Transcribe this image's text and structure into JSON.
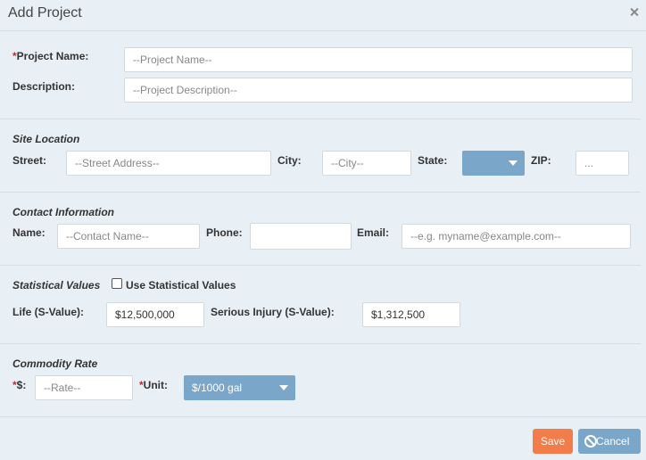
{
  "dialog": {
    "title": "Add Project"
  },
  "project": {
    "name_label_req": "*",
    "name_label": "Project Name:",
    "name_placeholder": "--Project Name--",
    "description_label": "Description:",
    "description_placeholder": "--Project Description--"
  },
  "site_location": {
    "heading": "Site Location",
    "street_label": "Street:",
    "street_placeholder": "--Street Address--",
    "city_label": "City:",
    "city_placeholder": "--City--",
    "state_label": "State:",
    "state_value": "",
    "zip_label": "ZIP:",
    "zip_placeholder": "..."
  },
  "contact": {
    "heading": "Contact Information",
    "name_label": "Name:",
    "name_placeholder": "--Contact Name--",
    "phone_label": "Phone:",
    "phone_value": "",
    "email_label": "Email:",
    "email_placeholder": "--e.g. myname@example.com--"
  },
  "statistical": {
    "heading": "Statistical Values",
    "use_label": "Use Statistical Values",
    "use_checked": false,
    "life_label": "Life (S-Value):",
    "life_value": "$12,500,000",
    "injury_label": "Serious Injury (S-Value):",
    "injury_value": "$1,312,500"
  },
  "commodity": {
    "heading": "Commodity Rate",
    "rate_req": "*",
    "rate_label": "$:",
    "rate_placeholder": "--Rate--",
    "unit_req": "*",
    "unit_label": "Unit:",
    "unit_value": "$/1000 gal"
  },
  "footer": {
    "save_label": "Save",
    "cancel_label": "Cancel"
  },
  "colors": {
    "accent": "#7aa6c9",
    "save": "#f27d4a",
    "required": "#c0272d",
    "background": "#e8eff5"
  }
}
